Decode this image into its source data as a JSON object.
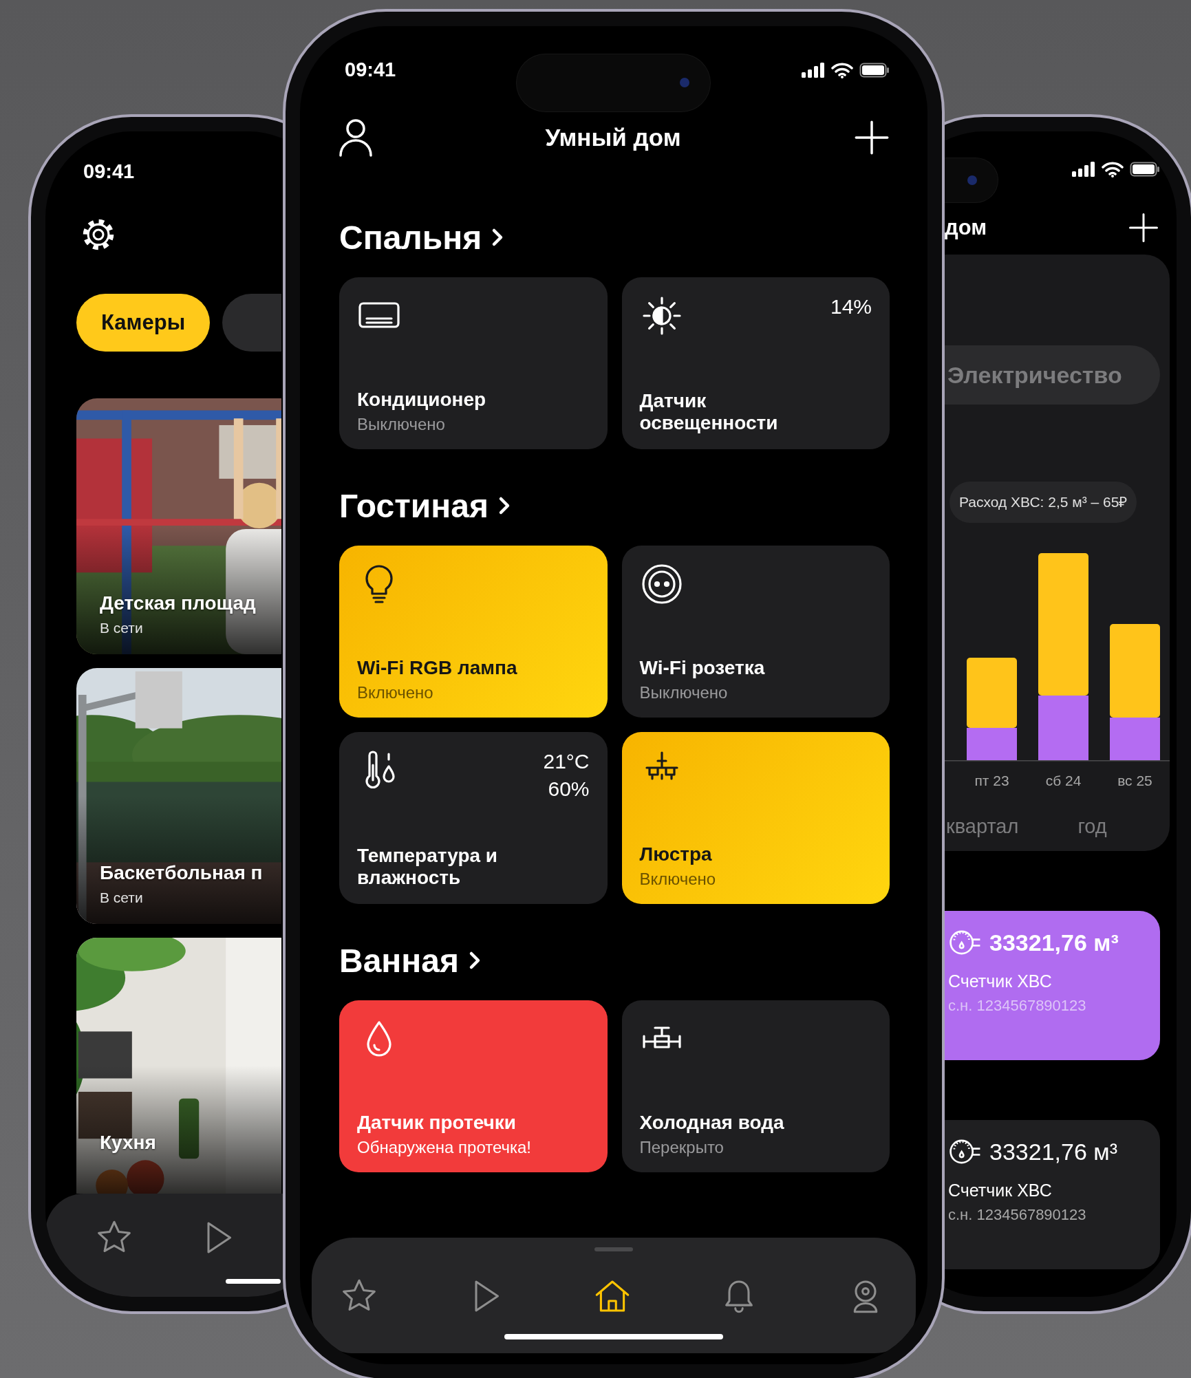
{
  "left_phone": {
    "status_bar": {
      "time": "09:41"
    },
    "tabs": [
      {
        "label": "Камеры",
        "selected": true
      }
    ],
    "cameras": [
      {
        "title": "Детская площад",
        "status": "В сети"
      },
      {
        "title": "Баскетбольная п",
        "status": "В сети"
      },
      {
        "title": "Кухня"
      }
    ],
    "nav": [
      {
        "kind": "star",
        "selected": false
      },
      {
        "kind": "play",
        "selected": false
      }
    ]
  },
  "main_phone": {
    "status_bar": {
      "time": "09:41"
    },
    "title": "Умный дом",
    "sections": [
      {
        "title": "Спальня",
        "devices": [
          {
            "kind": "conditioner",
            "name": "Кондиционер",
            "status": "Выключено",
            "on": false,
            "alarm": false
          },
          {
            "kind": "lightsensor",
            "name": "Датчик освещенности",
            "values": [
              "14%"
            ],
            "on": false,
            "alarm": false
          }
        ]
      },
      {
        "title": "Гостиная",
        "devices": [
          {
            "kind": "lamp",
            "name": "Wi-Fi RGB лампа",
            "status": "Включено",
            "on": true,
            "alarm": false
          },
          {
            "kind": "socket",
            "name": "Wi-Fi розетка",
            "status": "Выключено",
            "on": false,
            "alarm": false
          },
          {
            "kind": "climate",
            "name": "Температура и влажность",
            "values": [
              "21°C",
              "60%"
            ],
            "on": false,
            "alarm": false
          },
          {
            "kind": "chandelier",
            "name": "Люстра",
            "status": "Включено",
            "on": true,
            "alarm": false
          }
        ]
      },
      {
        "title": "Ванная",
        "devices": [
          {
            "kind": "leak",
            "name": "Датчик протечки",
            "status": "Обнаружена протечка!",
            "alarm": true
          },
          {
            "kind": "valve",
            "name": "Холодная вода",
            "status": "Перекрыто",
            "on": false,
            "alarm": false
          }
        ]
      }
    ],
    "nav": [
      {
        "kind": "star",
        "selected": false
      },
      {
        "kind": "play",
        "selected": false
      },
      {
        "kind": "home",
        "selected": true
      },
      {
        "kind": "bell",
        "selected": false
      },
      {
        "kind": "webcam",
        "selected": false
      }
    ]
  },
  "right_phone": {
    "title": "дом",
    "resource_tabs": [
      {
        "label": "Электричество",
        "selected": false
      }
    ],
    "summary": "Расход ХВС: 2,5 м³ – 65₽",
    "chart_labels": [
      "пт 23",
      "сб 24",
      "вс 25"
    ],
    "periods": [
      {
        "label": "квартал",
        "selected": false
      },
      {
        "label": "год",
        "selected": false
      }
    ],
    "meters": [
      {
        "reading": "33321,76 м³",
        "name": "Счетчик ХВС",
        "serial": "с.н. 1234567890123",
        "selected": true
      },
      {
        "reading": "33321,76 м³",
        "name": "Счетчик ХВС",
        "serial": "с.н. 1234567890123",
        "selected": false
      }
    ]
  }
}
